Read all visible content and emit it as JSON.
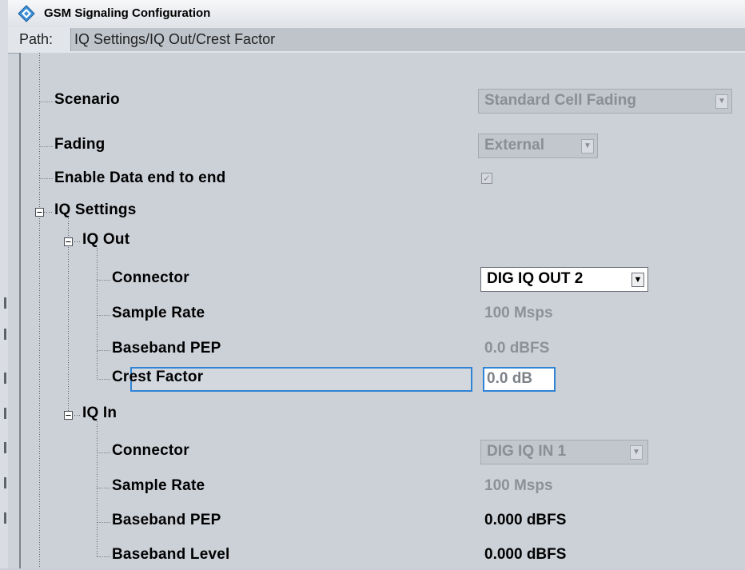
{
  "window": {
    "title": "GSM Signaling Configuration",
    "icon": "rohde-schwarz-diamond-icon"
  },
  "path": {
    "label": "Path:",
    "value": "IQ Settings/IQ Out/Crest Factor"
  },
  "tree": {
    "scenario": {
      "label": "Scenario",
      "value": "Standard Cell Fading"
    },
    "fading": {
      "label": "Fading",
      "value": "External"
    },
    "enable_data": {
      "label": "Enable Data end to end",
      "checked": true
    },
    "iq_settings": {
      "label": "IQ Settings",
      "expander": "⊟"
    },
    "iq_out": {
      "label": "IQ Out",
      "expander": "⊟",
      "connector": {
        "label": "Connector",
        "value": "DIG IQ OUT 2"
      },
      "sample_rate": {
        "label": "Sample Rate",
        "value": "100 Msps"
      },
      "baseband_pep": {
        "label": "Baseband PEP",
        "value": "0.0 dBFS"
      },
      "crest_factor": {
        "label": "Crest Factor",
        "value": "0.0 dB"
      }
    },
    "iq_in": {
      "label": "IQ In",
      "expander": "⊟",
      "connector": {
        "label": "Connector",
        "value": "DIG IQ IN 1"
      },
      "sample_rate": {
        "label": "Sample Rate",
        "value": "100 Msps"
      },
      "baseband_pep": {
        "label": "Baseband PEP",
        "value": "0.000 dBFS"
      },
      "baseband_level": {
        "label": "Baseband Level",
        "value": "0.000 dBFS"
      }
    }
  },
  "colors": {
    "focus": "#2f84d6",
    "disabled_text": "#8d9097",
    "panel": "#ccd1d8"
  }
}
